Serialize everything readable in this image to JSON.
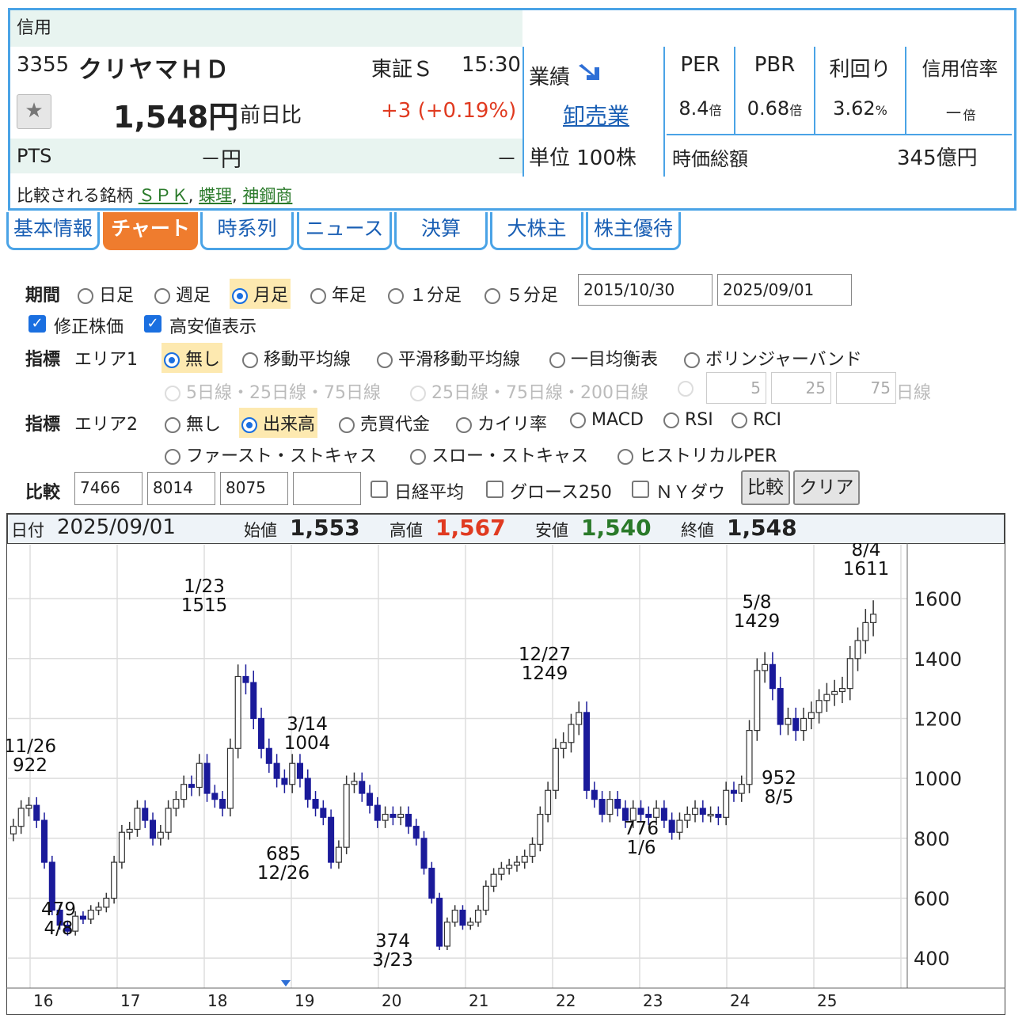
{
  "header": {
    "badge": "信用",
    "code": "3355",
    "name": "クリヤマＨＤ",
    "market": "東証Ｓ",
    "time": "15:30",
    "price": "1,548円",
    "change_label": "前日比",
    "change": "+3 (+0.19%)",
    "pts_label": "PTS",
    "pts_value": "－円",
    "pts_change": "－",
    "compare_label": "比較される銘柄",
    "compare": [
      "ＳＰＫ",
      "蝶理",
      "神鋼商"
    ],
    "results_label": "業績",
    "sector": "卸売業",
    "unit": "単位 100株",
    "metrics": [
      {
        "title": "PER",
        "value": "8.4",
        "unit": "倍"
      },
      {
        "title": "PBR",
        "value": "0.68",
        "unit": "倍"
      },
      {
        "title": "利回り",
        "value": "3.62",
        "unit": "%"
      },
      {
        "title": "信用倍率",
        "value": "－",
        "unit": "倍"
      }
    ],
    "market_cap_label": "時価総額",
    "market_cap": "345億円"
  },
  "tabs": [
    "基本情報",
    "チャート",
    "時系列",
    "ニュース",
    "決算",
    "大株主",
    "株主優待"
  ],
  "active_tab": "チャート",
  "form": {
    "period_label": "期間",
    "periods": [
      "日足",
      "週足",
      "月足",
      "年足",
      "１分足",
      "５分足"
    ],
    "selected_period": "月足",
    "date_from": "2015/10/30",
    "date_to": "2025/09/01",
    "adjusted": "修正株価",
    "show_hilo": "高安値表示",
    "indicator_label": "指標",
    "area1_label": "エリア1",
    "area1_options": [
      "無し",
      "移動平均線",
      "平滑移動平均線",
      "一目均衡表",
      "ボリンジャーバンド"
    ],
    "area1_sub": [
      "5日線・25日線・75日線",
      "25日線・75日線・200日線"
    ],
    "ma_inputs": [
      "5",
      "25",
      "75"
    ],
    "ma_unit": "日線",
    "area2_label": "エリア2",
    "area2_options": [
      "無し",
      "出来高",
      "売買代金",
      "カイリ率",
      "MACD",
      "RSI",
      "RCI",
      "ファースト・ストキャス",
      "スロー・ストキャス",
      "ヒストリカルPER"
    ],
    "compare_label": "比較",
    "compare_codes": [
      "7466",
      "8014",
      "8075",
      ""
    ],
    "compare_checks": [
      "日経平均",
      "グロース250",
      "ＮＹダウ"
    ],
    "compare_button": "比較",
    "clear_button": "クリア"
  },
  "chart_info": {
    "date_label": "日付",
    "date": "2025/09/01",
    "open_label": "始値",
    "open": "1,553",
    "high_label": "高値",
    "high": "1,567",
    "low_label": "安値",
    "low": "1,540",
    "close_label": "終値",
    "close": "1,548"
  },
  "chart_data": {
    "type": "candlestick",
    "ylim": [
      300,
      1780
    ],
    "yticks": [
      400,
      600,
      800,
      1000,
      1200,
      1400,
      1600
    ],
    "xticks": [
      "16",
      "17",
      "18",
      "19",
      "20",
      "21",
      "22",
      "23",
      "24",
      "25"
    ],
    "annotations": [
      {
        "date": "11/26",
        "value": 922
      },
      {
        "date": "4/8",
        "value": 479
      },
      {
        "date": "1/23",
        "value": 1515
      },
      {
        "date": "3/14",
        "value": 1004
      },
      {
        "date": "12/26",
        "value": 685
      },
      {
        "date": "3/23",
        "value": 374
      },
      {
        "date": "12/27",
        "value": 1249
      },
      {
        "date": "1/6",
        "value": 776
      },
      {
        "date": "5/8",
        "value": 1429
      },
      {
        "date": "8/5",
        "value": 952
      },
      {
        "date": "8/4",
        "value": 1611
      }
    ],
    "closes": [
      840,
      900,
      910,
      860,
      720,
      560,
      510,
      490,
      540,
      530,
      560,
      570,
      600,
      720,
      820,
      830,
      900,
      860,
      800,
      820,
      900,
      930,
      980,
      970,
      1050,
      950,
      930,
      900,
      1100,
      1340,
      1320,
      1200,
      1100,
      1050,
      1000,
      980,
      1050,
      1000,
      930,
      900,
      870,
      720,
      770,
      980,
      990,
      950,
      910,
      860,
      880,
      870,
      880,
      840,
      800,
      700,
      600,
      440,
      520,
      560,
      510,
      520,
      560,
      640,
      680,
      700,
      710,
      720,
      740,
      780,
      880,
      960,
      1100,
      1120,
      1180,
      1220,
      960,
      930,
      880,
      930,
      900,
      860,
      900,
      880,
      870,
      900,
      860,
      820,
      860,
      880,
      900,
      880,
      880,
      870,
      960,
      950,
      980,
      1160,
      1360,
      1380,
      1300,
      1180,
      1200,
      1160,
      1200,
      1220,
      1260,
      1280,
      1290,
      1300,
      1400,
      1460,
      1520,
      1548
    ]
  }
}
